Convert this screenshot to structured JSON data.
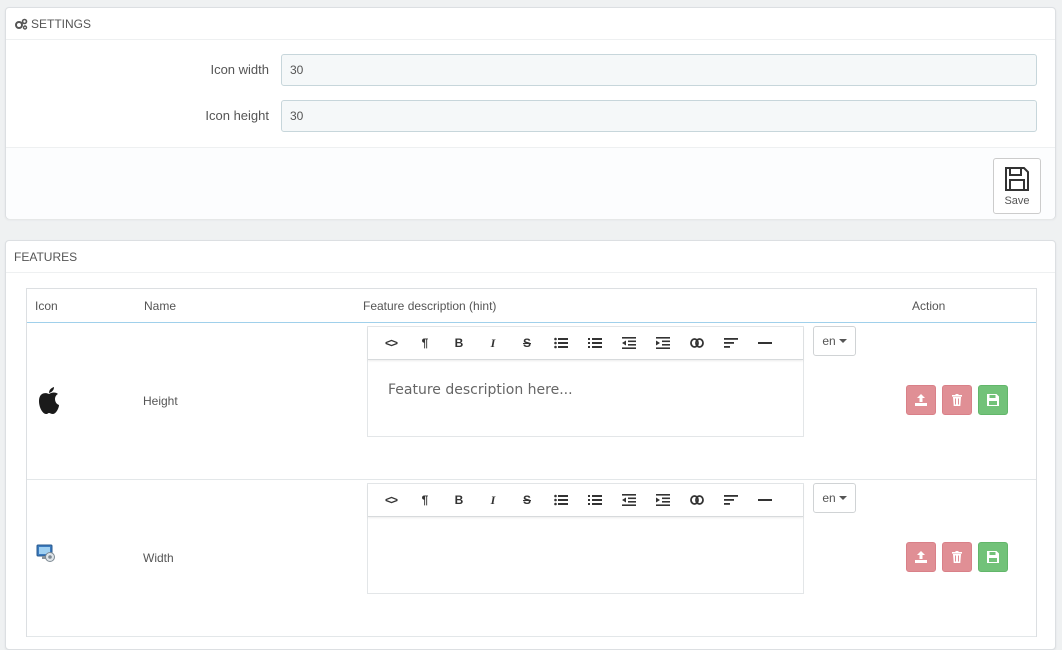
{
  "settings": {
    "title": "SETTINGS",
    "icon_width_label": "Icon width",
    "icon_width_value": "30",
    "icon_height_label": "Icon height",
    "icon_height_value": "30",
    "save_label": "Save"
  },
  "features": {
    "title": "FEATURES",
    "columns": {
      "icon": "Icon",
      "name": "Name",
      "description": "Feature description (hint)",
      "action": "Action"
    },
    "toolbar": {
      "code": "<>",
      "paragraph": "¶",
      "bold": "B",
      "italic": "I",
      "strike": "S"
    },
    "rows": [
      {
        "name": "Height",
        "icon": "apple-icon",
        "description": "Feature description here...",
        "lang": "en"
      },
      {
        "name": "Width",
        "icon": "monitor-icon",
        "description": "",
        "lang": "en"
      }
    ]
  },
  "colors": {
    "danger": "#e08f95",
    "success": "#72c279",
    "header_border": "#a0d0eb"
  }
}
